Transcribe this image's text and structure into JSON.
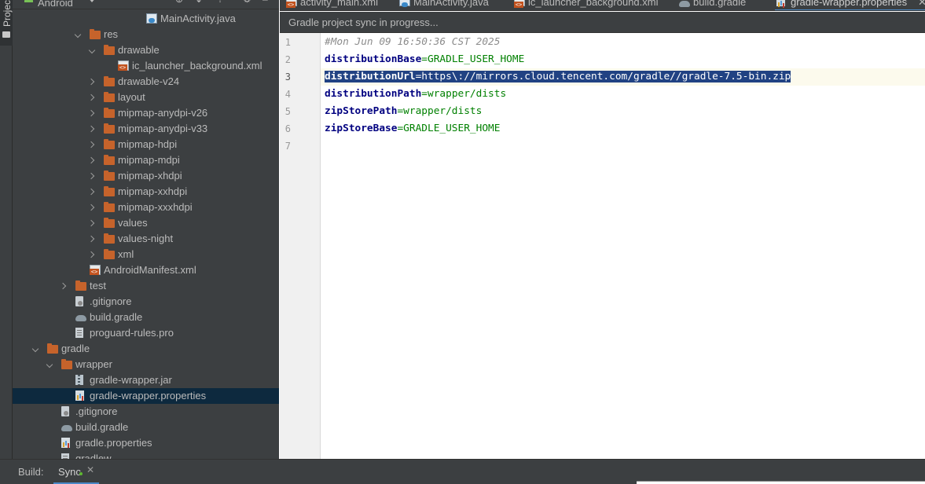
{
  "sidebar_tool": {
    "label": "Project"
  },
  "project_panel": {
    "view": "Android",
    "tree": [
      {
        "label": "MainActivity.java",
        "depth": 9,
        "arrow": "none",
        "icon": "java"
      },
      {
        "label": "res",
        "depth": 5,
        "arrow": "down",
        "icon": "folder"
      },
      {
        "label": "drawable",
        "depth": 6,
        "arrow": "down",
        "icon": "folder"
      },
      {
        "label": "ic_launcher_background.xml",
        "depth": 7,
        "arrow": "none",
        "icon": "xml"
      },
      {
        "label": "drawable-v24",
        "depth": 6,
        "arrow": "right",
        "icon": "folder"
      },
      {
        "label": "layout",
        "depth": 6,
        "arrow": "right",
        "icon": "folder"
      },
      {
        "label": "mipmap-anydpi-v26",
        "depth": 6,
        "arrow": "right",
        "icon": "folder"
      },
      {
        "label": "mipmap-anydpi-v33",
        "depth": 6,
        "arrow": "right",
        "icon": "folder"
      },
      {
        "label": "mipmap-hdpi",
        "depth": 6,
        "arrow": "right",
        "icon": "folder"
      },
      {
        "label": "mipmap-mdpi",
        "depth": 6,
        "arrow": "right",
        "icon": "folder"
      },
      {
        "label": "mipmap-xhdpi",
        "depth": 6,
        "arrow": "right",
        "icon": "folder"
      },
      {
        "label": "mipmap-xxhdpi",
        "depth": 6,
        "arrow": "right",
        "icon": "folder"
      },
      {
        "label": "mipmap-xxxhdpi",
        "depth": 6,
        "arrow": "right",
        "icon": "folder"
      },
      {
        "label": "values",
        "depth": 6,
        "arrow": "right",
        "icon": "folder"
      },
      {
        "label": "values-night",
        "depth": 6,
        "arrow": "right",
        "icon": "folder"
      },
      {
        "label": "xml",
        "depth": 6,
        "arrow": "right",
        "icon": "folder"
      },
      {
        "label": "AndroidManifest.xml",
        "depth": 5,
        "arrow": "none",
        "icon": "xml"
      },
      {
        "label": "test",
        "depth": 4,
        "arrow": "right",
        "icon": "folder"
      },
      {
        "label": ".gitignore",
        "depth": 4,
        "arrow": "none",
        "icon": "git"
      },
      {
        "label": "build.gradle",
        "depth": 4,
        "arrow": "none",
        "icon": "gradle"
      },
      {
        "label": "proguard-rules.pro",
        "depth": 4,
        "arrow": "none",
        "icon": "pro"
      },
      {
        "label": "gradle",
        "depth": 2,
        "arrow": "down",
        "icon": "folder"
      },
      {
        "label": "wrapper",
        "depth": 3,
        "arrow": "down",
        "icon": "folder"
      },
      {
        "label": "gradle-wrapper.jar",
        "depth": 4,
        "arrow": "none",
        "icon": "jar"
      },
      {
        "label": "gradle-wrapper.properties",
        "depth": 4,
        "arrow": "none",
        "icon": "props",
        "selected": true
      },
      {
        "label": ".gitignore",
        "depth": 3,
        "arrow": "none",
        "icon": "git"
      },
      {
        "label": "build.gradle",
        "depth": 3,
        "arrow": "none",
        "icon": "gradle"
      },
      {
        "label": "gradle.properties",
        "depth": 3,
        "arrow": "none",
        "icon": "props"
      },
      {
        "label": "gradlew",
        "depth": 3,
        "arrow": "none",
        "icon": "pro"
      }
    ]
  },
  "editor_tabs": [
    {
      "label": "activity_main.xml",
      "icon": "xml"
    },
    {
      "label": "MainActivity.java",
      "icon": "java"
    },
    {
      "label": "ic_launcher_background.xml",
      "icon": "xml"
    },
    {
      "label": "build.gradle",
      "icon": "gradle"
    },
    {
      "label": "gradle-wrapper.properties",
      "icon": "props",
      "active": true
    }
  ],
  "sync_banner": {
    "text": "Gradle project sync in progress..."
  },
  "editor": {
    "current_line": 3,
    "lines": [
      {
        "num": "1",
        "comment": "#Mon Jun 09 16:50:36 CST 2025"
      },
      {
        "num": "2",
        "key": "distributionBase",
        "eq": "=",
        "value": "GRADLE_USER_HOME"
      },
      {
        "num": "3",
        "key": "distributionUrl",
        "eq": "=",
        "value": "https\\://mirrors.cloud.tencent.com/gradle//gradle-7.5-bin.zip",
        "selected": true
      },
      {
        "num": "4",
        "key": "distributionPath",
        "eq": "=",
        "value": "wrapper/dists"
      },
      {
        "num": "5",
        "key": "zipStorePath",
        "eq": "=",
        "value": "wrapper/dists"
      },
      {
        "num": "6",
        "key": "zipStoreBase",
        "eq": "=",
        "value": "GRADLE_USER_HOME"
      },
      {
        "num": "7"
      }
    ]
  },
  "build_bar": {
    "label": "Build:",
    "tab_label": "Sync"
  }
}
